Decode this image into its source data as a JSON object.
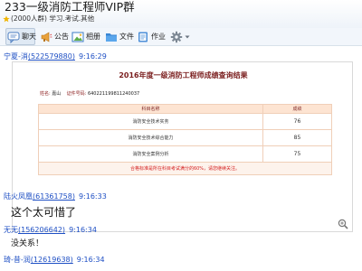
{
  "header": {
    "group_title": "233一级消防工程师VIP群",
    "group_subtitle": "(2000人群) 学习.考试.其他"
  },
  "toolbar": {
    "chat_label": "聊天",
    "announcement_label": "公告",
    "album_label": "相册",
    "files_label": "文件",
    "homework_label": "作业"
  },
  "messages": [
    {
      "sender": "宁夏-消",
      "qq": "(522579880)",
      "time": "9:16:29",
      "image": {
        "title": "2016年度一级消防工程师成绩查询结果",
        "name_label": "姓名:",
        "name_value": "嘉山",
        "id_label": "证件号码:",
        "id_value": "640221199811240037",
        "columns": [
          "科目名称",
          "成绩"
        ],
        "rows": [
          {
            "subject": "消防安全技术实务",
            "score": "76"
          },
          {
            "subject": "消防安全技术综合能力",
            "score": "85"
          },
          {
            "subject": "消防安全案例分析",
            "score": "75"
          }
        ],
        "note": "合格标准是所在科目考试满分的60%，请您继续关注。"
      }
    },
    {
      "sender": "陆火凤凰",
      "qq": "(61361758)",
      "time": "9:16:33",
      "text": "这个太可惜了"
    },
    {
      "sender": "无无",
      "qq": "(156206642)",
      "time": "9:16:34",
      "text": "没关系！"
    },
    {
      "sender": "琦-昔-润",
      "qq": "(12619638)",
      "time": "9:16:34"
    }
  ]
}
